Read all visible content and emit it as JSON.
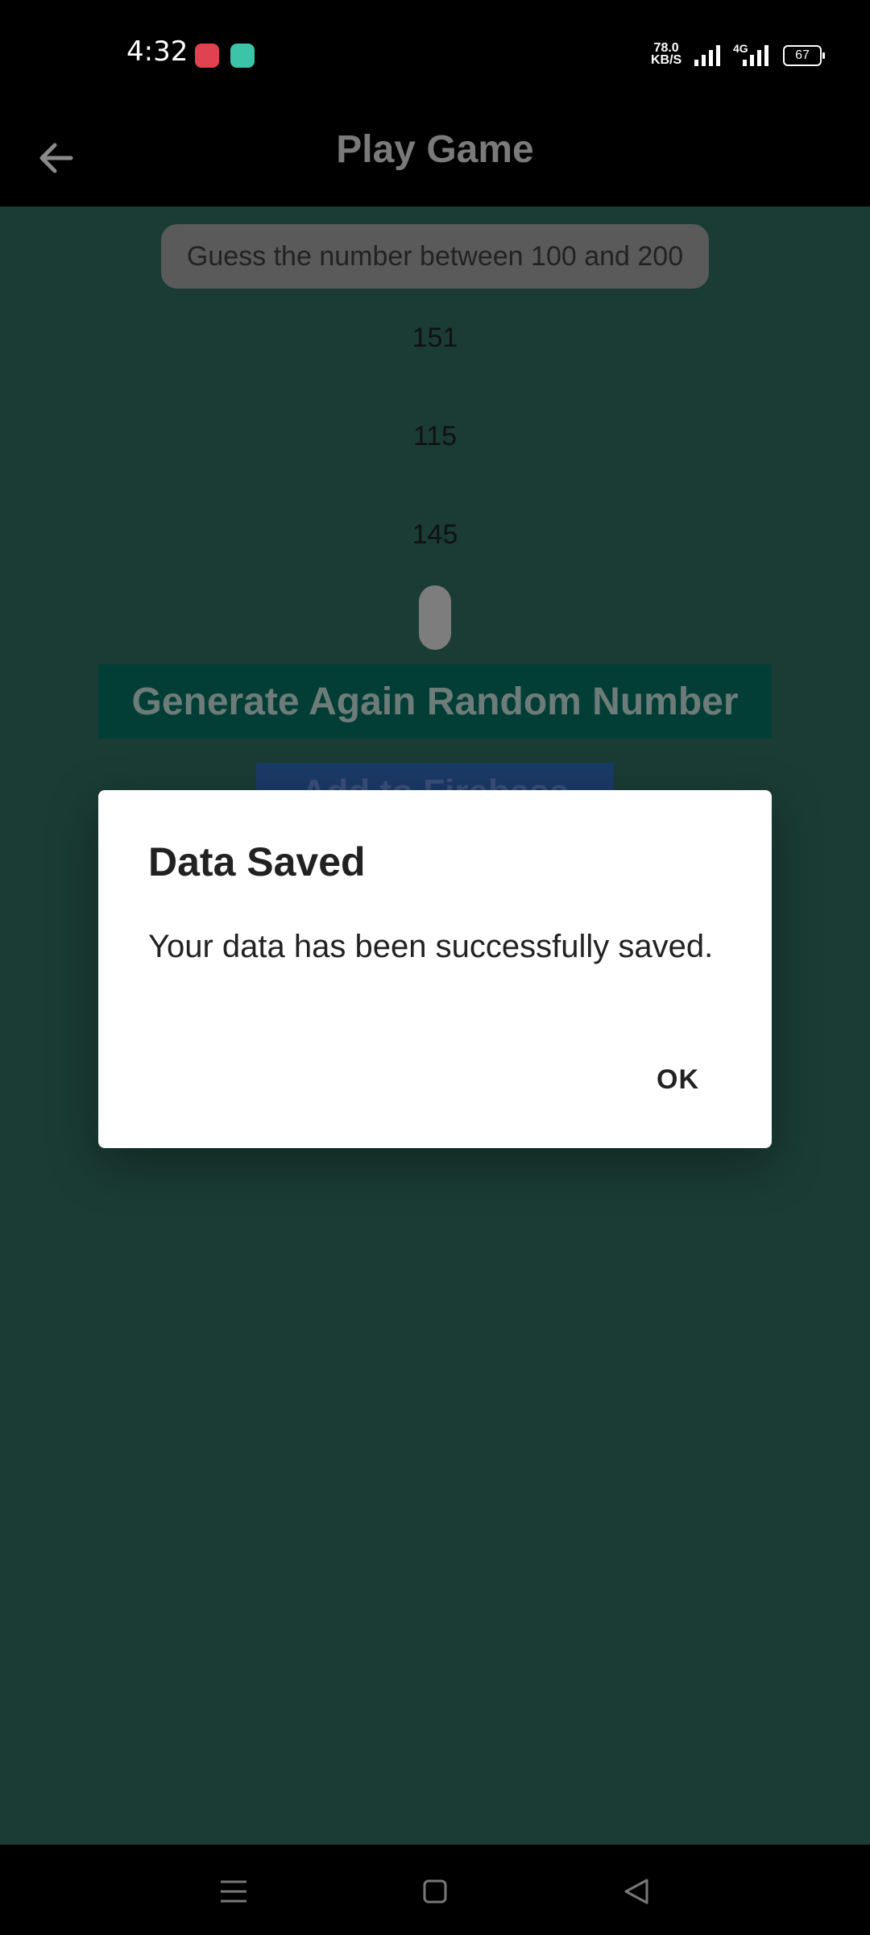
{
  "status_bar": {
    "time": "4:32",
    "speed_value": "78.0",
    "speed_unit": "KB/S",
    "network": "4G",
    "battery": "67"
  },
  "app_bar": {
    "title": "Play Game",
    "back_icon": "arrow-left-icon"
  },
  "game": {
    "prompt": "Guess the number between 100 and 200",
    "guesses": [
      "151",
      "115",
      "145"
    ],
    "generate_button": "Generate Again Random Number",
    "add_button": "Add to Firebase"
  },
  "dialog": {
    "title": "Data Saved",
    "message": "Your data has been successfully saved.",
    "ok_label": "OK"
  },
  "nav_bar": {
    "icons": [
      "menu-icon",
      "home-icon",
      "back-triangle-icon"
    ]
  },
  "colors": {
    "content_bg": "#1a3c34",
    "bars_bg": "#000000",
    "generate_button_bg": "#033e36",
    "add_button_bg": "#1b3a67",
    "dialog_bg": "#ffffff"
  }
}
